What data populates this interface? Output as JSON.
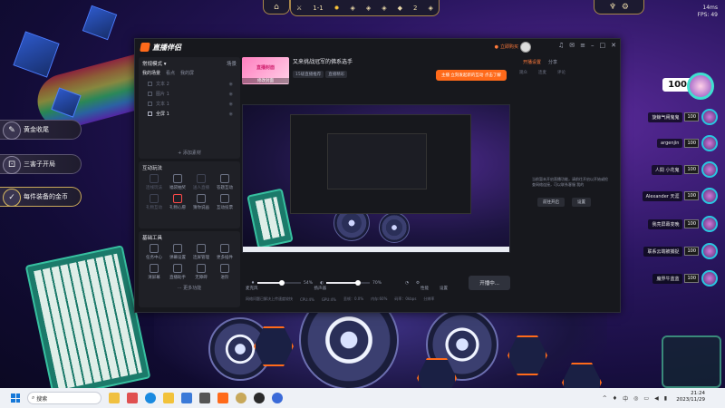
{
  "hud": {
    "stage": "1-1",
    "gold": "2",
    "fps_ping": "14ms",
    "fps": "FPS: 49"
  },
  "left_hud": [
    "黄金收尾",
    "三害子开局",
    "每件装备的金币"
  ],
  "players": [
    {
      "name": "",
      "hp": "100"
    },
    {
      "name": "旋鲸气闸鬼鬼",
      "hp": "100"
    },
    {
      "name": "argenjin",
      "hp": "100"
    },
    {
      "name": "人間 小花鬼",
      "hp": "100"
    },
    {
      "name": "Alexander 天涯",
      "hp": "100"
    },
    {
      "name": "我亮屏幕变晚",
      "hp": "100"
    },
    {
      "name": "联系云端被捕捉",
      "hp": "100"
    },
    {
      "name": "魔界牛蓝蓝",
      "hp": "100"
    }
  ],
  "app": {
    "name": "直播伴侣",
    "upload_label": "立即购买",
    "left": {
      "mode_label": "常规模式 ▾",
      "scene_label": "场景",
      "tabs": [
        "我的场景",
        "看点",
        "我的屏"
      ],
      "sources": [
        {
          "name": "文本 2",
          "on": false
        },
        {
          "name": "图片 1",
          "on": false
        },
        {
          "name": "文本 1",
          "on": false
        },
        {
          "name": "全屏 1",
          "on": true
        }
      ],
      "add_source": "+ 添加素材",
      "interact_title": "互动玩法",
      "interact_items": [
        {
          "label": "连线玩法",
          "dim": true
        },
        {
          "label": "福袋抽奖",
          "dim": false
        },
        {
          "label": "送人直播",
          "dim": true
        },
        {
          "label": "答题互动",
          "dim": false
        },
        {
          "label": "礼物互动",
          "dim": true
        },
        {
          "label": "礼物心愿",
          "dim": false
        },
        {
          "label": "猜你说画",
          "dim": false
        },
        {
          "label": "互动投票",
          "dim": false
        }
      ],
      "tools_title": "基础工具",
      "tool_items": [
        {
          "label": "任务中心"
        },
        {
          "label": "弹幕设置"
        },
        {
          "label": "连屏管理"
        },
        {
          "label": "更多插件"
        },
        {
          "label": "清屏幕"
        },
        {
          "label": "直播助手"
        },
        {
          "label": "无障碍"
        },
        {
          "label": "进阶"
        }
      ],
      "more_label": "··· 更多功能"
    },
    "center": {
      "cover_text": "直播封面",
      "cover_button": "修改封面",
      "room_title": "又来挑战冠军的佛系选手",
      "chips": [
        "15级直播推荐",
        "直播精彩"
      ],
      "mic_label": "麦克风",
      "mic_value": "54%",
      "speaker_label": "扬声器",
      "speaker_value": "70%",
      "perf_label": "性能",
      "settings_label": "设置",
      "start_button": "开播中...",
      "stats": [
        "网络问题已解决上传速度较快",
        "CPU:4%",
        "GPU:4%",
        "丢帧：0.0%",
        "内存:60%",
        "码率：0kbps",
        "分辨率"
      ]
    },
    "right": {
      "tabs": [
        "开播设置",
        "分享"
      ],
      "sub_tabs": [
        "观众",
        "连麦",
        "评论"
      ],
      "tip": "主播 立刻发起新的互动   点击了解",
      "notice": "当前暂未开启直播功能，请前往开启以开始或检查网络连接，可以联系客服 我的",
      "btn_open": "前往开启",
      "btn_settings": "设置"
    }
  },
  "taskbar": {
    "search": "搜索",
    "time": "21:24",
    "date": "2023/11/29"
  }
}
